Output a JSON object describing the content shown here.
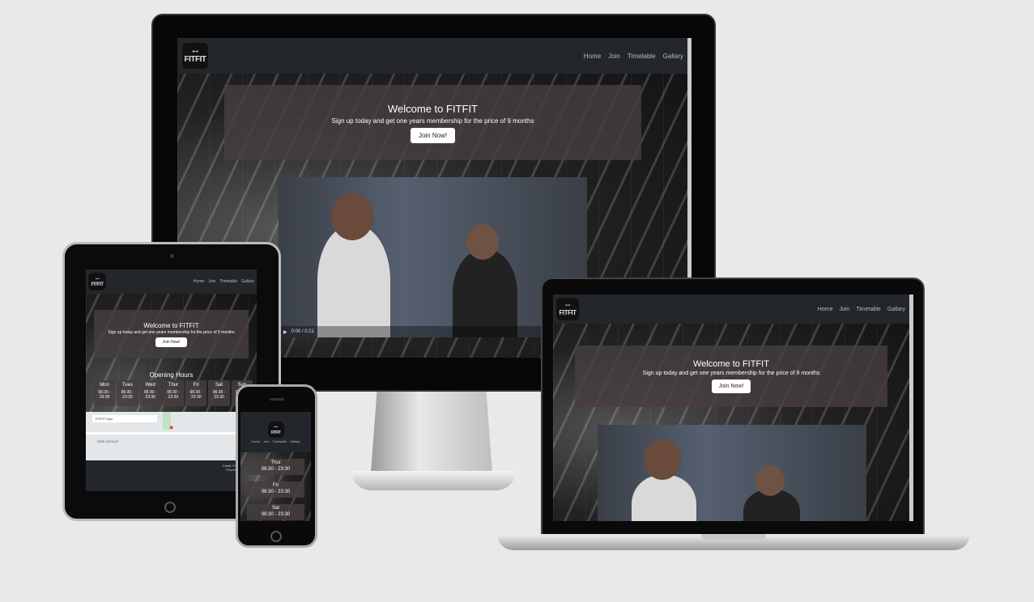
{
  "brand": {
    "logo_text": "FITFIT",
    "logo_icon": "dumbbell-icon"
  },
  "nav": {
    "links": [
      "Home",
      "Join",
      "Timetable",
      "Gallary"
    ]
  },
  "hero": {
    "title": "Welcome to FITFIT",
    "subtitle": "Sign up today and get one years membership for the price of 9 months",
    "button": "Join Now!"
  },
  "video": {
    "time": "0:00 / 0:21"
  },
  "opening_hours": {
    "title": "Opening Hours",
    "days": [
      "Mon",
      "Tues",
      "Wed",
      "Thur",
      "Fri",
      "Sat",
      "Sun"
    ],
    "hours": "06:30 - 23:30",
    "phone_days": [
      "Thur",
      "Fri",
      "Sat"
    ]
  },
  "map": {
    "place": "FITFIT Gym",
    "road": "RISE AVENUE"
  },
  "footer": {
    "email": "Email: FITFIT@gym",
    "phone": "Phone: 01 23 456"
  },
  "colors": {
    "nav": "#23272b",
    "hero_overlay": "#463e3e",
    "button": "#ffffff",
    "device_frame": "#070707",
    "page_bg": "#e9e9e9"
  }
}
